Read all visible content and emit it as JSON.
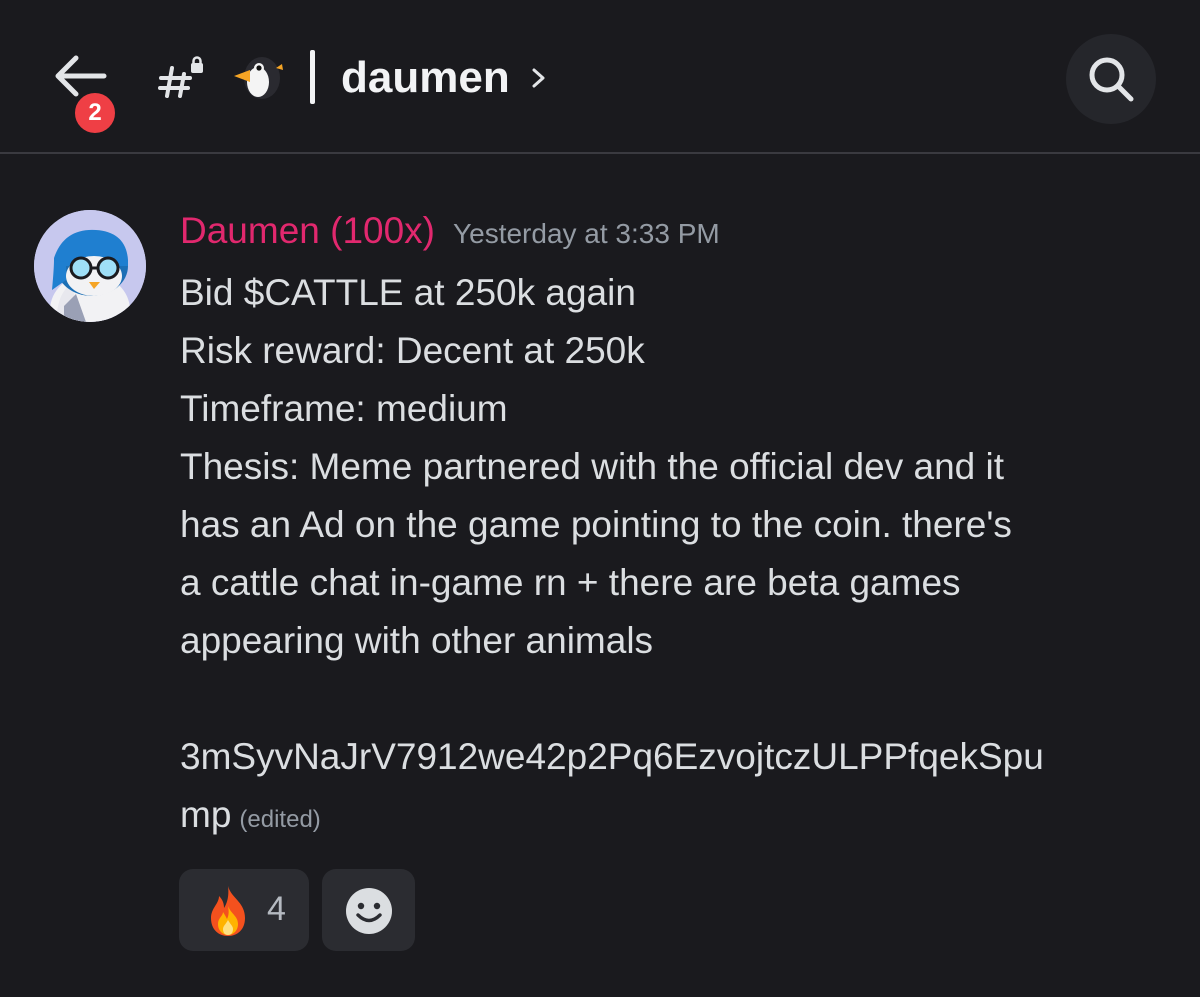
{
  "header": {
    "back_badge_count": "2",
    "channel_name": "daumen",
    "channel_emoji": "penguin-icon",
    "channel_type_icon": "locked-hashtag-icon",
    "search_icon": "search-icon"
  },
  "message": {
    "author": "Daumen (100x)",
    "author_color": "#e1286e",
    "timestamp": "Yesterday at 3:33 PM",
    "lines": [
      "Bid $CATTLE at 250k again",
      "Risk reward:  Decent at 250k",
      "Timeframe: medium",
      "Thesis: Meme partnered with the official dev and it",
      "has an Ad on the game pointing to the coin. there's",
      "a cattle chat in-game rn + there are beta games",
      "appearing with other animals",
      "",
      "3mSyvNaJrV7912we42p2Pq6EzvojtczULPPfqekSpu",
      "mp"
    ],
    "edited_label": "(edited)"
  },
  "reactions": [
    {
      "emoji": "fire-icon",
      "count": "4"
    },
    {
      "emoji": "add-reaction-icon"
    }
  ]
}
